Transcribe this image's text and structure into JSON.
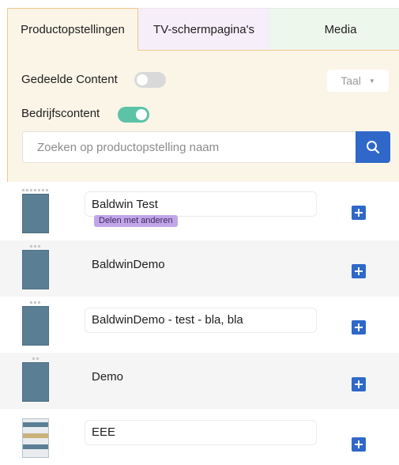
{
  "tabs": [
    {
      "label": "Productopstellingen"
    },
    {
      "label": "TV-schermpagina's"
    },
    {
      "label": "Media"
    }
  ],
  "filters": {
    "shared_content_label": "Gedeelde Content",
    "shared_content_on": false,
    "company_content_label": "Bedrijfscontent",
    "company_content_on": true,
    "language_select": "Taal"
  },
  "search": {
    "placeholder": "Zoeken op productopstelling naam",
    "value": ""
  },
  "items": [
    {
      "name": "Baldwin Test",
      "badge": "Delen met anderen"
    },
    {
      "name": "BaldwinDemo"
    },
    {
      "name": "BaldwinDemo - test - bla, bla"
    },
    {
      "name": "Demo"
    },
    {
      "name": "EEE"
    }
  ],
  "icons": {
    "search": "search-icon",
    "add": "plus-icon",
    "dropdown": "caret-down-icon"
  },
  "colors": {
    "accent": "#2f68c9",
    "toggle_on": "#5cc3a7",
    "toggle_off": "#d9d9d9",
    "badge": "#c2a6ea",
    "panel_bg": "#fbf5e8"
  }
}
